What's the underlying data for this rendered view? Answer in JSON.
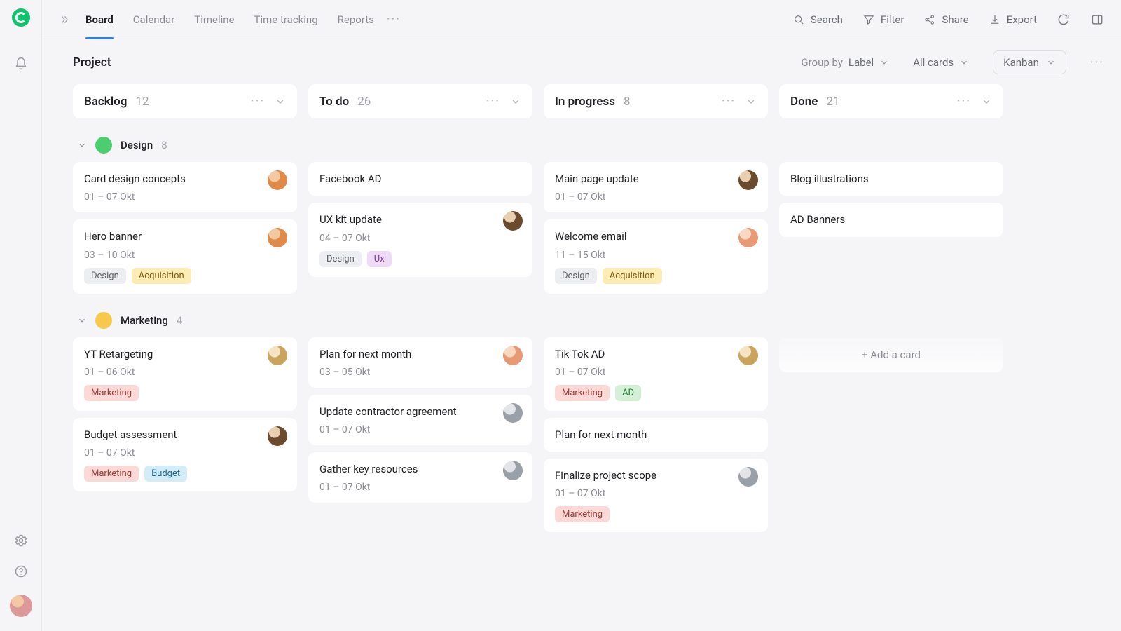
{
  "nav": {
    "tabs": [
      "Board",
      "Calendar",
      "Timeline",
      "Time tracking",
      "Reports"
    ],
    "activeIndex": 0,
    "actions": {
      "search": "Search",
      "filter": "Filter",
      "share": "Share",
      "export": "Export"
    }
  },
  "board": {
    "title": "Project",
    "groupByLabel": "Group by",
    "groupByValue": "Label",
    "cardsFilterLabel": "All cards",
    "viewMode": "Kanban"
  },
  "columns": [
    {
      "id": "backlog",
      "title": "Backlog",
      "count": 12
    },
    {
      "id": "todo",
      "title": "To do",
      "count": 26
    },
    {
      "id": "inprogress",
      "title": "In progress",
      "count": 8
    },
    {
      "id": "done",
      "title": "Done",
      "count": 21
    }
  ],
  "lanes": [
    {
      "id": "design",
      "name": "Design",
      "count": 8,
      "color": "green",
      "cards": {
        "backlog": [
          {
            "title": "Card design concepts",
            "date": "01 – 07 Okt",
            "avatar": "orange"
          },
          {
            "title": "Hero banner",
            "date": "03 – 10 Okt",
            "avatar": "orange",
            "tags": [
              {
                "t": "Design",
                "c": "grey"
              },
              {
                "t": "Acquisition",
                "c": "yellow"
              }
            ]
          }
        ],
        "todo": [
          {
            "title": "Facebook AD"
          },
          {
            "title": "UX kit update",
            "date": "04 – 07 Okt",
            "avatar": "brown",
            "tags": [
              {
                "t": "Design",
                "c": "grey"
              },
              {
                "t": "Ux",
                "c": "purple"
              }
            ]
          }
        ],
        "inprogress": [
          {
            "title": "Main page update",
            "date": "01 – 07 Okt",
            "avatar": "brown"
          },
          {
            "title": "Welcome email",
            "date": "11 – 15 Okt",
            "avatar": "peach",
            "tags": [
              {
                "t": "Design",
                "c": "grey"
              },
              {
                "t": "Acquisition",
                "c": "yellow"
              }
            ]
          }
        ],
        "done": [
          {
            "title": "Blog illustrations"
          },
          {
            "title": "AD Banners"
          }
        ]
      }
    },
    {
      "id": "marketing",
      "name": "Marketing",
      "count": 4,
      "color": "yellow",
      "cards": {
        "backlog": [
          {
            "title": "YT Retargeting",
            "date": "01 – 06 Okt",
            "avatar": "blonde",
            "tags": [
              {
                "t": "Marketing",
                "c": "pink"
              }
            ]
          },
          {
            "title": "Budget assessment",
            "date": "01 – 07 Okt",
            "avatar": "brown",
            "tags": [
              {
                "t": "Marketing",
                "c": "pink"
              },
              {
                "t": "Budget",
                "c": "blue"
              }
            ]
          }
        ],
        "todo": [
          {
            "title": "Plan for next month",
            "date": "03 – 05 Okt",
            "avatar": "peach"
          },
          {
            "title": "Update contractor agreement",
            "date": "01 – 07 Okt",
            "avatar": "grey"
          },
          {
            "title": "Gather key resources",
            "date": "01 – 07 Okt",
            "avatar": "grey"
          }
        ],
        "inprogress": [
          {
            "title": "Tik Tok AD",
            "date": "01 – 07 Okt",
            "avatar": "blonde",
            "tags": [
              {
                "t": "Marketing",
                "c": "pink"
              },
              {
                "t": "AD",
                "c": "green"
              }
            ]
          },
          {
            "title": "Plan for next month"
          },
          {
            "title": "Finalize project scope",
            "date": "01 – 07 Okt",
            "avatar": "grey",
            "tags": [
              {
                "t": "Marketing",
                "c": "pink"
              }
            ]
          }
        ],
        "done": [
          {
            "addCard": true,
            "label": "+ Add a card"
          }
        ]
      }
    }
  ]
}
